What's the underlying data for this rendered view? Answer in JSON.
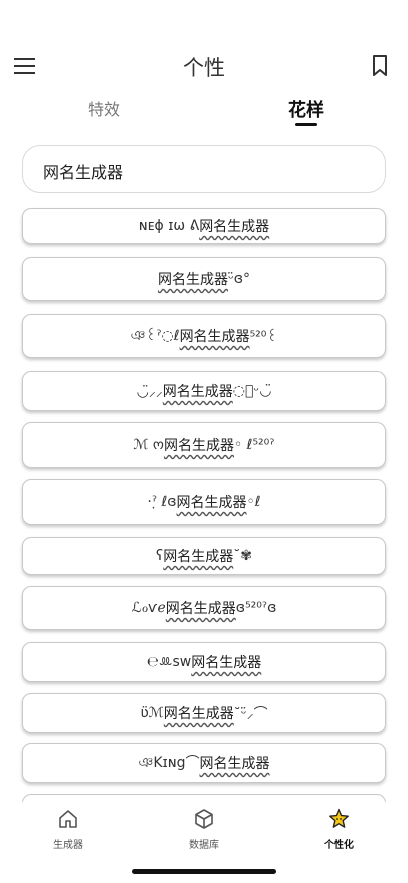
{
  "header": {
    "title": "个性"
  },
  "tabs": [
    {
      "label": "特效"
    },
    {
      "label": "花样"
    }
  ],
  "search": {
    "value": "网名生成器"
  },
  "results": [
    {
      "prefix": "ɴᴇɸ ɪω ᕕ",
      "name": "网名生成器",
      "suffix": ""
    },
    {
      "prefix": "",
      "name": "网名生成器",
      "suffix": "ᵕ̈ɞ°"
    },
    {
      "prefix": "ঞ꒰ˀ◌ℓ",
      "name": "网名生成器",
      "suffix": "⁵²⁰꒰"
    },
    {
      "prefix": "◡̈⸝⸝",
      "name": "网名生成器",
      "suffix": "◌⃝ᵕ◡̈"
    },
    {
      "prefix": "ℳ ო",
      "name": "网名生成器",
      "suffix": "◦ ℓ⁵²⁰ˀ"
    },
    {
      "prefix": "·ˀ̣ ℓɞ",
      "name": "网名生成器",
      "suffix": "◦ℓ"
    },
    {
      "prefix": "ʕ",
      "name": "网名生成器",
      "suffix": "˘✾"
    },
    {
      "prefix": "ℒℴѵℯ",
      "name": "网名生成器",
      "suffix": "ɞ⁵²⁰ˀɞ"
    },
    {
      "prefix": "℮ꔛsw",
      "name": "网名生成器",
      "suffix": ""
    },
    {
      "prefix": "ʋ̈ℳ",
      "name": "网名生成器",
      "suffix": "˘ᵕ̈⸝⌒"
    },
    {
      "prefix": "ঞKɪɴg⌒ ",
      "name": "网名生成器",
      "suffix": ""
    }
  ],
  "bottom_nav": [
    {
      "label": "生成器",
      "icon": "home-icon"
    },
    {
      "label": "数据库",
      "icon": "cube-icon"
    },
    {
      "label": "个性化",
      "icon": "star-icon"
    }
  ]
}
